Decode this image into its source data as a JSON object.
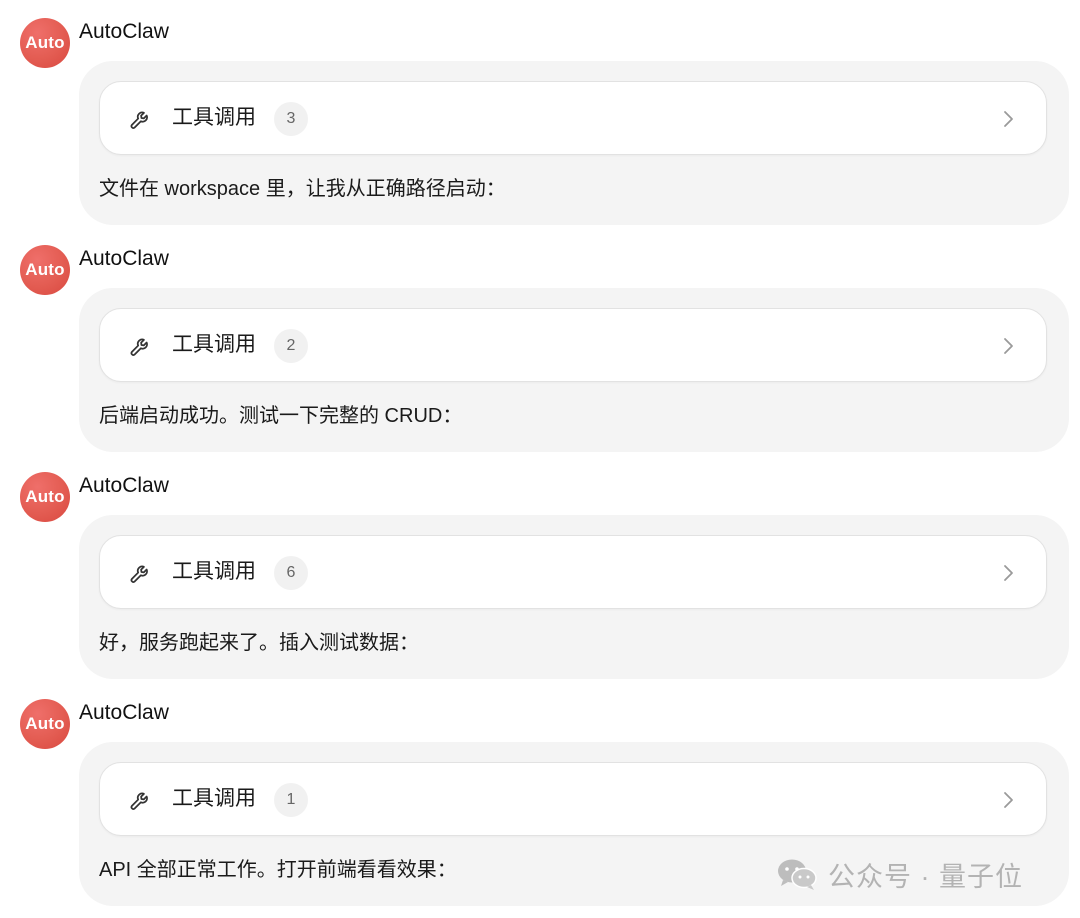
{
  "theme": {
    "avatar_color": "#e35c52",
    "bubble_bg": "#f4f4f4",
    "card_border": "#e2e2e2"
  },
  "messages": [
    {
      "avatar_text": "Auto",
      "sender": "AutoClaw",
      "tool_label": "工具调用",
      "tool_count": "3",
      "tool_icon": "wrench-icon",
      "text": "文件在 workspace 里，让我从正确路径启动："
    },
    {
      "avatar_text": "Auto",
      "sender": "AutoClaw",
      "tool_label": "工具调用",
      "tool_count": "2",
      "tool_icon": "wrench-icon",
      "text": "后端启动成功。测试一下完整的 CRUD："
    },
    {
      "avatar_text": "Auto",
      "sender": "AutoClaw",
      "tool_label": "工具调用",
      "tool_count": "6",
      "tool_icon": "wrench-icon",
      "text": "好，服务跑起来了。插入测试数据："
    },
    {
      "avatar_text": "Auto",
      "sender": "AutoClaw",
      "tool_label": "工具调用",
      "tool_count": "1",
      "tool_icon": "wrench-icon",
      "text": "API 全部正常工作。打开前端看看效果："
    }
  ],
  "watermark": {
    "icon": "wechat-icon",
    "text": "公众号 · 量子位"
  }
}
